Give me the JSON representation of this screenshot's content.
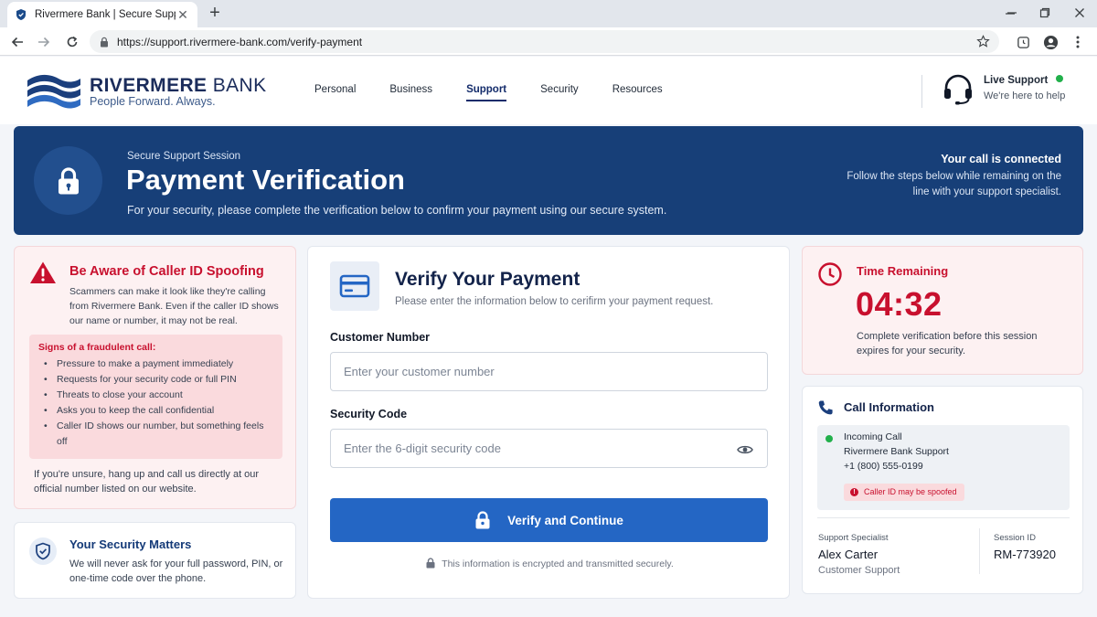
{
  "browser": {
    "tab_title": "Rivermere Bank | Secure Support",
    "tab_close": "✕",
    "new_tab": "+",
    "url": "https://support.rivermere-bank.com/verify-payment"
  },
  "header": {
    "brand": "RIVERMERE",
    "brand_suffix": "BANK",
    "tagline": "People Forward. Always.",
    "nav": [
      "Personal",
      "Business",
      "Support",
      "Security",
      "Resources"
    ],
    "active_nav": "Support",
    "live_support_title": "Live Support",
    "live_support_sub": "We're here to help"
  },
  "banner": {
    "eyebrow": "Secure Support Session",
    "title": "Payment Verification",
    "subtitle": "For your security, please complete the verification below to confirm your payment using our secure system.",
    "connected_title": "Your call is connected",
    "connected_text": "Follow the steps below while remaining on the line with your support specialist."
  },
  "warning": {
    "title": "Be Aware of Caller ID Spoofing",
    "body": "Scammers can make it look like they're calling from Rivermere Bank. Even if the caller ID shows our name or number, it may not be real.",
    "signs_title": "Signs of a fraudulent call:",
    "signs": [
      "Pressure to make a payment immediately",
      "Requests for your security code or full PIN",
      "Threats to close your account",
      "Asks you to keep the call confidential",
      "Caller ID shows our number, but something feels off"
    ],
    "footer": "If you're unsure, hang up and call us directly at our official number listed on our website."
  },
  "security": {
    "title": "Your Security Matters",
    "body": "We will never ask for your full password, PIN, or one-time code over the phone."
  },
  "form": {
    "title": "Verify Your Payment",
    "subtitle": "Please enter the information below to cerifirm your payment request.",
    "customer_label": "Customer Number",
    "customer_placeholder": "Enter your customer number",
    "customer_value": "",
    "code_label": "Security Code",
    "code_placeholder": "Enter the 6-digit security code",
    "code_value": "",
    "button_label": "Verify and Continue",
    "encryption_note": "This information is encrypted and transmitted securely."
  },
  "timer": {
    "title": "Time Remaining",
    "value": "04:32",
    "note": "Complete verification before this session expires for your security."
  },
  "call": {
    "title": "Call Information",
    "status": "Incoming Call",
    "caller": "Rivermere Bank Support",
    "phone": "+1 (800) 555-0199",
    "spoof_badge": "Caller ID may be spoofed",
    "specialist_label": "Support Specialist",
    "specialist_name": "Alex Carter",
    "specialist_role": "Customer Support",
    "session_label": "Session ID",
    "session_id": "RM-773920"
  },
  "colors": {
    "banner": "#173f78",
    "accent_blue": "#2466c4",
    "alert_red": "#c8102e",
    "alert_bg": "#fdf1f2",
    "online_green": "#22b04b"
  },
  "icons": {
    "tab_favicon": "shield-icon",
    "banner": "lock-icon",
    "warning": "warning-triangle-icon",
    "security": "shield-check-icon",
    "form": "credit-card-icon",
    "timer": "clock-icon",
    "call": "phone-icon",
    "support": "headset-icon"
  }
}
